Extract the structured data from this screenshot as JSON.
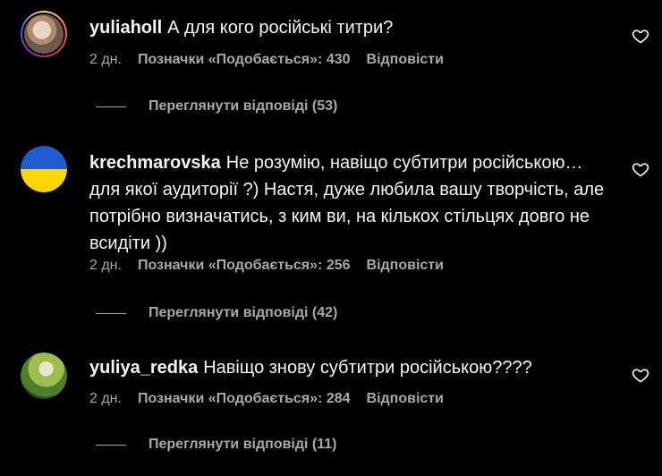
{
  "comments": [
    {
      "username": "yuliaholl",
      "text": "А для кого російські титри?",
      "time": "2 дн.",
      "likes": "Позначки «Подобається»: 430",
      "reply": "Відповісти",
      "view_replies": "Переглянути відповіді (53)",
      "avatar": "profile-photo"
    },
    {
      "username": "krechmarovska",
      "text": "Не розумію, навіщо субтитри російською… для якої аудиторії ?) Настя, дуже любила вашу творчість, але потрібно визначатись, з ким ви, на кількох стільцях довго не всидіти ))",
      "time": "2 дн.",
      "likes": "Позначки «Подобається»: 256",
      "reply": "Відповісти",
      "view_replies": "Переглянути відповіді (42)",
      "avatar": "ukraine-flag"
    },
    {
      "username": "yuliya_redka",
      "text": "Навіщо знову субтитри російською????",
      "time": "2 дн.",
      "likes": "Позначки «Подобається»: 284",
      "reply": "Відповісти",
      "view_replies": "Переглянути відповіді (11)",
      "avatar": "nature-photo"
    }
  ],
  "icons": {
    "like": "heart-icon"
  },
  "colors": {
    "background": "#000000",
    "text": "#f5f5f5",
    "muted": "#a8a8a8"
  }
}
